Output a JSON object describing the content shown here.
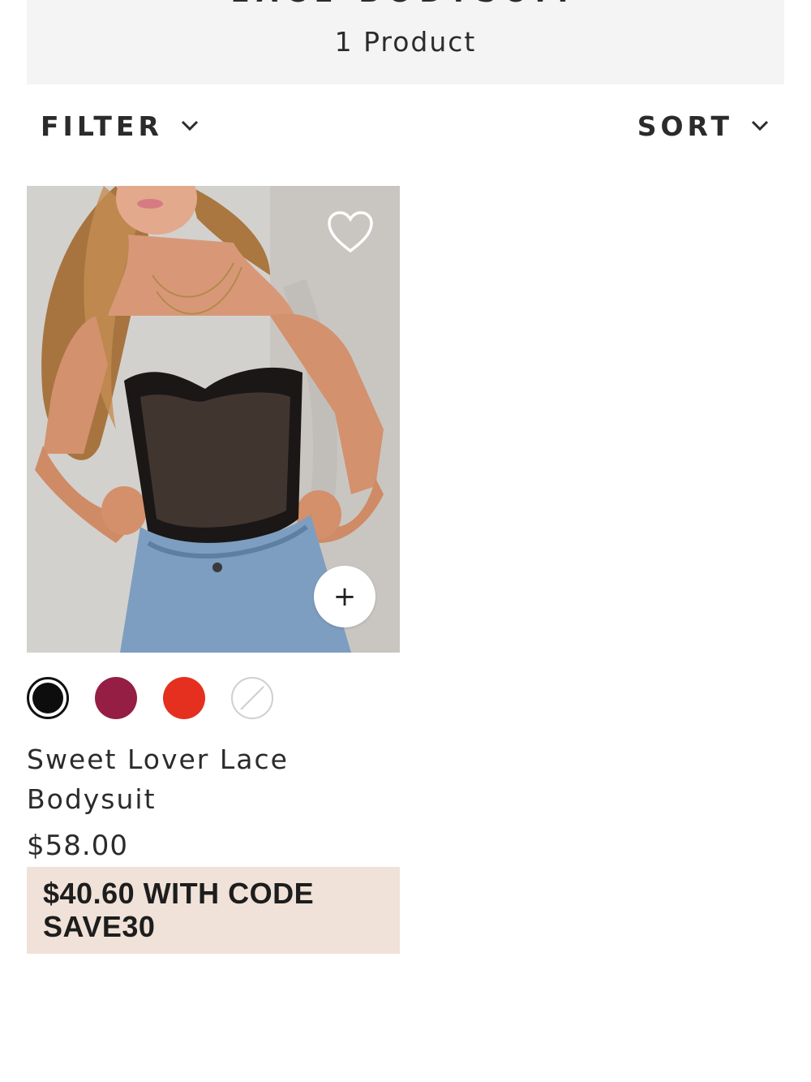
{
  "header": {
    "title": "LACE BODYSUIT",
    "count": "1 Product"
  },
  "toolbar": {
    "filter_label": "FILTER",
    "sort_label": "SORT"
  },
  "product": {
    "name": "Sweet Lover Lace Bodysuit",
    "price": "$58.00",
    "promo": "$40.60 WITH CODE SAVE30",
    "quick_add": "+",
    "swatches": [
      {
        "name": "black",
        "color": "#0d0d0d",
        "selected": true
      },
      {
        "name": "wine",
        "color": "#951e45",
        "selected": false
      },
      {
        "name": "red",
        "color": "#e5301f",
        "selected": false
      },
      {
        "name": "unavailable",
        "color": "#ffffff",
        "selected": false
      }
    ]
  },
  "colors": {
    "header_band": "#f4f4f4",
    "promo_bg": "#f0e2d8",
    "text": "#2b2b2b"
  }
}
